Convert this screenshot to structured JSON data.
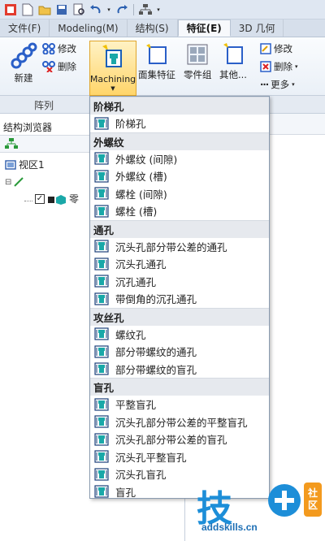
{
  "tabs": [
    {
      "label": "文件(F)"
    },
    {
      "label": "Modeling(M)"
    },
    {
      "label": "结构(S)"
    },
    {
      "label": "特征(E)",
      "active": true
    },
    {
      "label": "3D 几何"
    }
  ],
  "ribbon": {
    "new_label": "新建",
    "modify_label": "修改",
    "delete_label": "删除",
    "machining_label": "Machining",
    "surface_feature_label": "面集特征",
    "part_group_label": "零件组",
    "other_label": "其他...",
    "modify2_label": "修改",
    "delete2_label": "删除",
    "more_label": "更多"
  },
  "groups": {
    "array": "阵列"
  },
  "browser": {
    "title": "结构浏览器",
    "view_label": "视区1",
    "part_label": "零"
  },
  "menu": {
    "sections": [
      {
        "header": "阶梯孔",
        "items": [
          "阶梯孔"
        ]
      },
      {
        "header": "外螺纹",
        "items": [
          "外螺纹 (间隙)",
          "外螺纹 (槽)",
          "螺栓 (间隙)",
          "螺栓 (槽)"
        ]
      },
      {
        "header": "通孔",
        "items": [
          "沉头孔部分带公差的通孔",
          "沉头孔通孔",
          "沉孔通孔",
          "带倒角的沉孔通孔"
        ]
      },
      {
        "header": "攻丝孔",
        "items": [
          "螺纹孔",
          "部分带螺纹的通孔",
          "部分带螺纹的盲孔"
        ]
      },
      {
        "header": "盲孔",
        "items": [
          "平整盲孔",
          "沉头孔部分带公差的平整盲孔",
          "沉头孔部分带公差的盲孔",
          "沉头孔平整盲孔",
          "沉头孔盲孔",
          "盲孔"
        ]
      }
    ]
  },
  "watermark": {
    "big": "技",
    "badge_top": "社",
    "badge_bottom": "区",
    "url": "addskills.cn"
  },
  "colors": {
    "accent": "#1d8ed8",
    "icon_teal": "#1aa8a8",
    "highlight": "#ffd56a"
  }
}
